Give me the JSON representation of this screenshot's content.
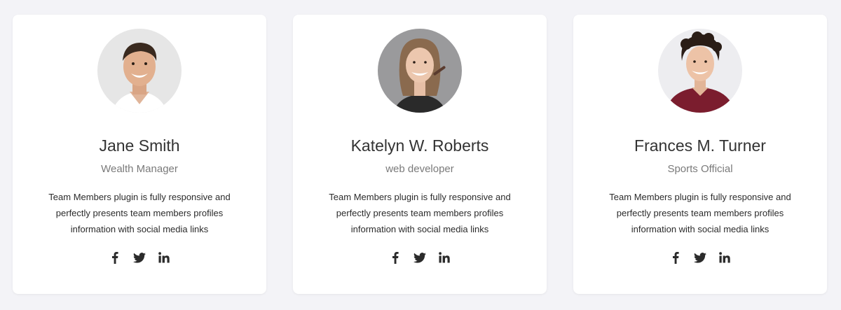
{
  "team": [
    {
      "name": "Jane Smith",
      "role": "Wealth Manager",
      "description": "Team Members plugin is fully responsive and perfectly presents team members profiles information with social media links",
      "photo": "smiling man in white shirt portrait"
    },
    {
      "name": "Katelyn W. Roberts",
      "role": "web developer",
      "description": "Team Members plugin is fully responsive and perfectly presents team members profiles information with social media links",
      "photo": "smiling woman applying makeup portrait"
    },
    {
      "name": "Frances M. Turner",
      "role": "Sports Official",
      "description": "Team Members plugin is fully responsive and perfectly presents team members profiles information with social media links",
      "photo": "curly-haired young man in maroon shirt portrait"
    }
  ],
  "social_icons": [
    "facebook-icon",
    "twitter-icon",
    "linkedin-icon"
  ],
  "colors": {
    "background": "#f3f3f7",
    "card": "#ffffff",
    "name": "#333333",
    "role": "#7a7a7a",
    "icon": "#2b2b2b"
  }
}
